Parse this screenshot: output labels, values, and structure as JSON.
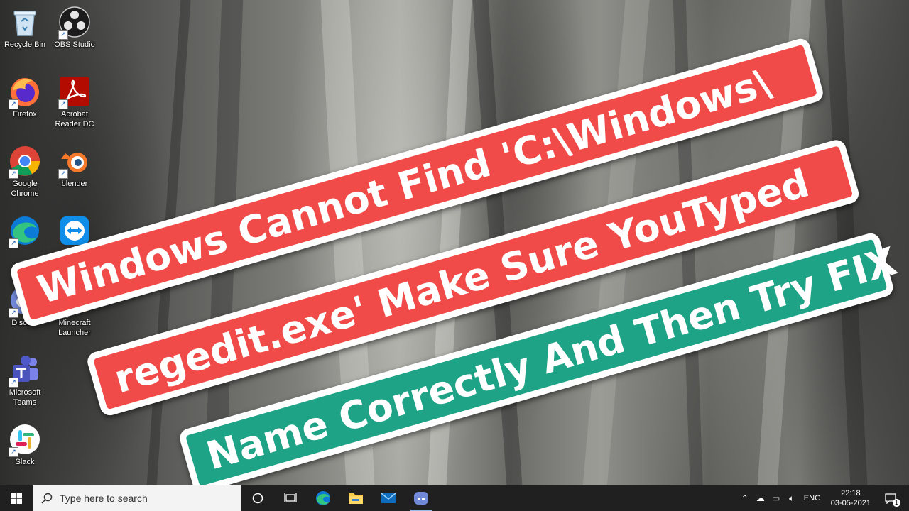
{
  "desktop": {
    "icons": [
      {
        "label": "Recycle Bin"
      },
      {
        "label": "OBS Studio"
      },
      {
        "label": "Firefox"
      },
      {
        "label": "Acrobat Reader DC"
      },
      {
        "label": "Google Chrome"
      },
      {
        "label": "blender"
      },
      {
        "label": "Discord"
      },
      {
        "label": "Minecraft Launcher"
      },
      {
        "label": "Microsoft Teams"
      },
      {
        "label": "Slack"
      }
    ]
  },
  "banners": {
    "line1": "Windows Cannot Find 'C:\\Windows\\",
    "line2": "regedit.exe' Make Sure YouTyped",
    "line3": "Name Correctly And Then Try FIX",
    "colors": {
      "red": "#f04b48",
      "teal": "#1fa386"
    }
  },
  "taskbar": {
    "search_placeholder": "Type here to search",
    "pinned": [
      "task-view",
      "edge",
      "file-explorer",
      "mail",
      "discord"
    ],
    "language": "ENG",
    "time": "22:18",
    "date": "03-05-2021",
    "notification_count": "1"
  }
}
